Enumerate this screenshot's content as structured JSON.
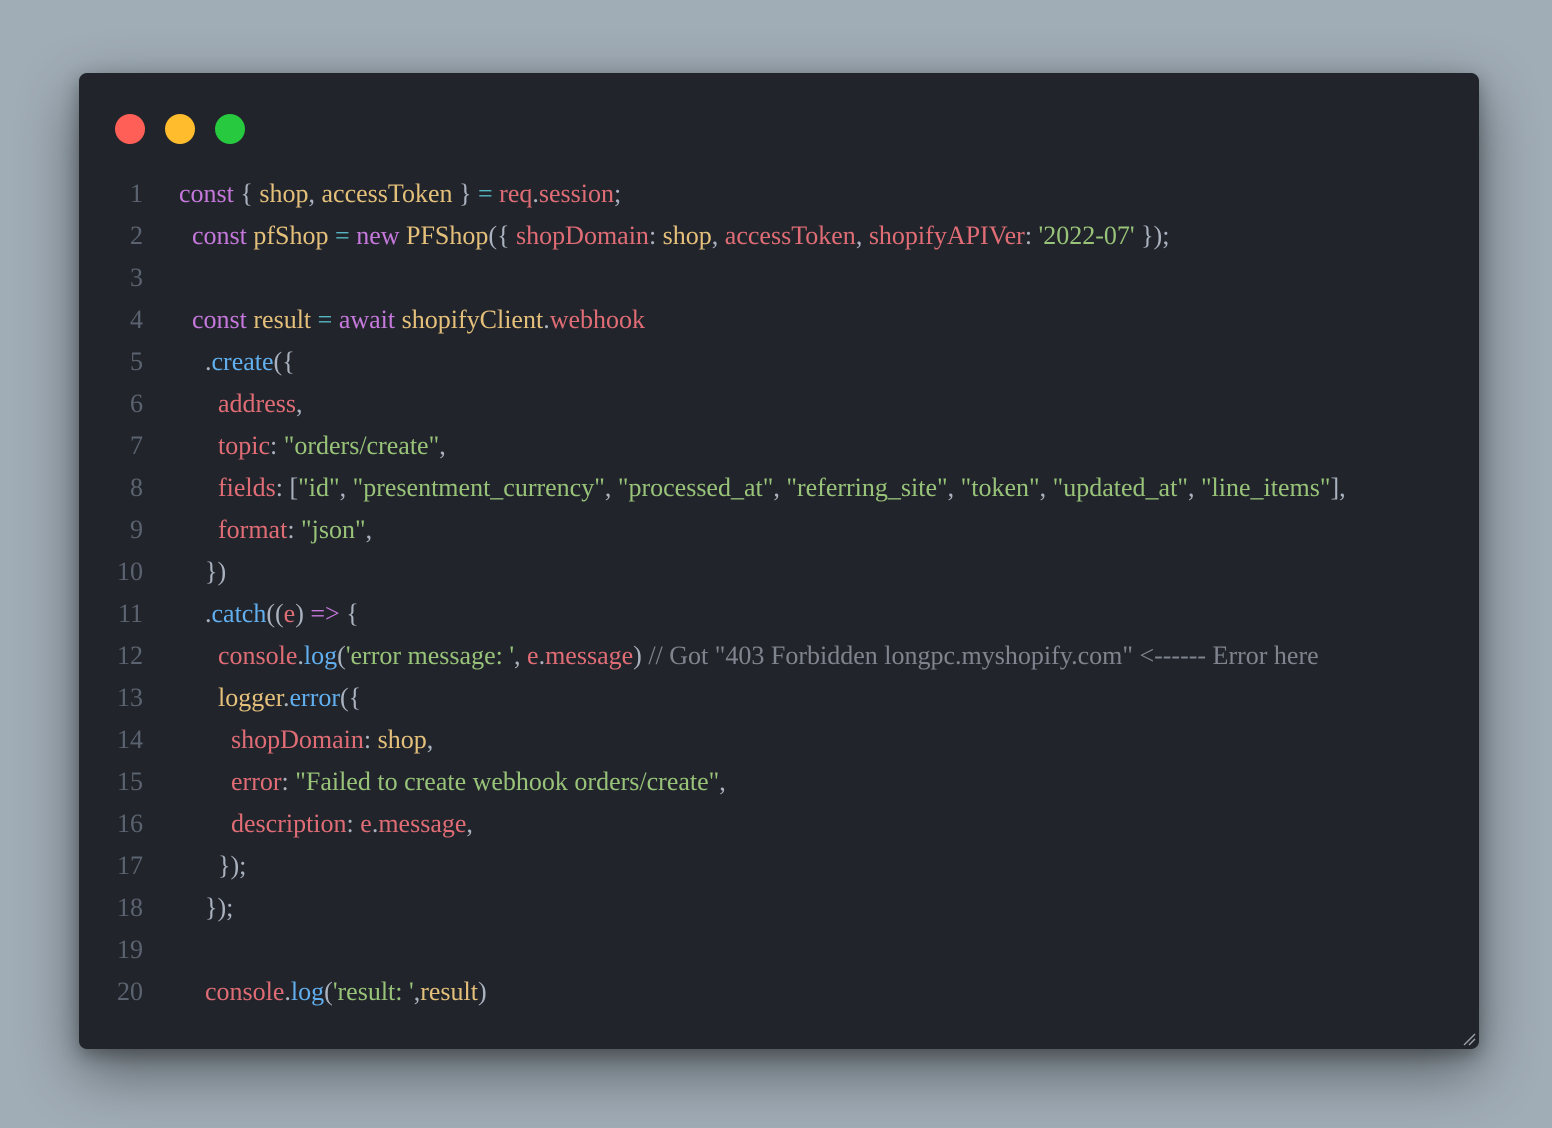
{
  "window": {
    "controls": [
      {
        "name": "close",
        "color": "#ff5f56"
      },
      {
        "name": "minimize",
        "color": "#ffbd2e"
      },
      {
        "name": "maximize",
        "color": "#27c93f"
      }
    ]
  },
  "code": {
    "lines": [
      {
        "n": "1",
        "indent": "",
        "tokens": [
          [
            "const",
            "kw"
          ],
          [
            " { ",
            "pun"
          ],
          [
            "shop",
            "var"
          ],
          [
            ", ",
            "pun"
          ],
          [
            "accessToken",
            "var"
          ],
          [
            " } ",
            "pun"
          ],
          [
            "=",
            "op"
          ],
          [
            " ",
            "pun"
          ],
          [
            "req",
            "prop"
          ],
          [
            ".",
            "pun"
          ],
          [
            "session",
            "prop"
          ],
          [
            ";",
            "pun"
          ]
        ]
      },
      {
        "n": "2",
        "indent": "  ",
        "tokens": [
          [
            "const",
            "kw"
          ],
          [
            " ",
            "pun"
          ],
          [
            "pfShop",
            "var"
          ],
          [
            " ",
            "pun"
          ],
          [
            "=",
            "op"
          ],
          [
            " ",
            "pun"
          ],
          [
            "new",
            "kw"
          ],
          [
            " ",
            "pun"
          ],
          [
            "PFShop",
            "var"
          ],
          [
            "({ ",
            "pun"
          ],
          [
            "shopDomain",
            "prop"
          ],
          [
            ": ",
            "pun"
          ],
          [
            "shop",
            "var"
          ],
          [
            ", ",
            "pun"
          ],
          [
            "accessToken",
            "prop"
          ],
          [
            ", ",
            "pun"
          ],
          [
            "shopifyAPIVer",
            "prop"
          ],
          [
            ": ",
            "pun"
          ],
          [
            "'2022-07'",
            "str"
          ],
          [
            " });",
            "pun"
          ]
        ]
      },
      {
        "n": "3",
        "indent": "",
        "tokens": []
      },
      {
        "n": "4",
        "indent": "  ",
        "tokens": [
          [
            "const",
            "kw"
          ],
          [
            " ",
            "pun"
          ],
          [
            "result",
            "var"
          ],
          [
            " ",
            "pun"
          ],
          [
            "=",
            "op"
          ],
          [
            " ",
            "pun"
          ],
          [
            "await",
            "kw"
          ],
          [
            " ",
            "pun"
          ],
          [
            "shopifyClient",
            "var"
          ],
          [
            ".",
            "pun"
          ],
          [
            "webhook",
            "prop"
          ]
        ]
      },
      {
        "n": "5",
        "indent": "    ",
        "tokens": [
          [
            ".",
            "pun"
          ],
          [
            "create",
            "fn"
          ],
          [
            "({",
            "pun"
          ]
        ]
      },
      {
        "n": "6",
        "indent": "      ",
        "tokens": [
          [
            "address",
            "prop"
          ],
          [
            ",",
            "pun"
          ]
        ]
      },
      {
        "n": "7",
        "indent": "      ",
        "tokens": [
          [
            "topic",
            "prop"
          ],
          [
            ": ",
            "pun"
          ],
          [
            "\"orders/create\"",
            "str"
          ],
          [
            ",",
            "pun"
          ]
        ]
      },
      {
        "n": "8",
        "indent": "      ",
        "tokens": [
          [
            "fields",
            "prop"
          ],
          [
            ": [",
            "pun"
          ],
          [
            "\"id\"",
            "str"
          ],
          [
            ", ",
            "pun"
          ],
          [
            "\"presentment_currency\"",
            "str"
          ],
          [
            ", ",
            "pun"
          ],
          [
            "\"processed_at\"",
            "str"
          ],
          [
            ", ",
            "pun"
          ],
          [
            "\"referring_site\"",
            "str"
          ],
          [
            ", ",
            "pun"
          ],
          [
            "\"token\"",
            "str"
          ],
          [
            ", ",
            "pun"
          ],
          [
            "\"updated_at\"",
            "str"
          ],
          [
            ", ",
            "pun"
          ],
          [
            "\"line_items\"",
            "str"
          ],
          [
            "],",
            "pun"
          ]
        ]
      },
      {
        "n": "9",
        "indent": "      ",
        "tokens": [
          [
            "format",
            "prop"
          ],
          [
            ": ",
            "pun"
          ],
          [
            "\"json\"",
            "str"
          ],
          [
            ",",
            "pun"
          ]
        ]
      },
      {
        "n": "10",
        "indent": "    ",
        "tokens": [
          [
            "})",
            "pun"
          ]
        ]
      },
      {
        "n": "11",
        "indent": "    ",
        "tokens": [
          [
            ".",
            "pun"
          ],
          [
            "catch",
            "fn"
          ],
          [
            "((",
            "pun"
          ],
          [
            "e",
            "prop"
          ],
          [
            ") ",
            "pun"
          ],
          [
            "=>",
            "kw"
          ],
          [
            " {",
            "pun"
          ]
        ]
      },
      {
        "n": "12",
        "indent": "      ",
        "tokens": [
          [
            "console",
            "prop"
          ],
          [
            ".",
            "pun"
          ],
          [
            "log",
            "fn"
          ],
          [
            "(",
            "pun"
          ],
          [
            "'error message: '",
            "str"
          ],
          [
            ", ",
            "pun"
          ],
          [
            "e",
            "prop"
          ],
          [
            ".",
            "pun"
          ],
          [
            "message",
            "prop"
          ],
          [
            ") ",
            "pun"
          ],
          [
            "// Got \"403 Forbidden longpc.myshopify.com\" <------ Error here",
            "cmt"
          ]
        ]
      },
      {
        "n": "13",
        "indent": "      ",
        "tokens": [
          [
            "logger",
            "var"
          ],
          [
            ".",
            "pun"
          ],
          [
            "error",
            "fn"
          ],
          [
            "({",
            "pun"
          ]
        ]
      },
      {
        "n": "14",
        "indent": "        ",
        "tokens": [
          [
            "shopDomain",
            "prop"
          ],
          [
            ": ",
            "pun"
          ],
          [
            "shop",
            "var"
          ],
          [
            ",",
            "pun"
          ]
        ]
      },
      {
        "n": "15",
        "indent": "        ",
        "tokens": [
          [
            "error",
            "prop"
          ],
          [
            ": ",
            "pun"
          ],
          [
            "\"Failed to create webhook orders/create\"",
            "str"
          ],
          [
            ",",
            "pun"
          ]
        ]
      },
      {
        "n": "16",
        "indent": "        ",
        "tokens": [
          [
            "description",
            "prop"
          ],
          [
            ": ",
            "pun"
          ],
          [
            "e",
            "prop"
          ],
          [
            ".",
            "pun"
          ],
          [
            "message",
            "prop"
          ],
          [
            ",",
            "pun"
          ]
        ]
      },
      {
        "n": "17",
        "indent": "      ",
        "tokens": [
          [
            "});",
            "pun"
          ]
        ]
      },
      {
        "n": "18",
        "indent": "    ",
        "tokens": [
          [
            "});",
            "pun"
          ]
        ]
      },
      {
        "n": "19",
        "indent": "",
        "tokens": []
      },
      {
        "n": "20",
        "indent": "    ",
        "tokens": [
          [
            "console",
            "prop"
          ],
          [
            ".",
            "pun"
          ],
          [
            "log",
            "fn"
          ],
          [
            "(",
            "pun"
          ],
          [
            "'result: '",
            "str"
          ],
          [
            ",",
            "pun"
          ],
          [
            "result",
            "var"
          ],
          [
            ")",
            "pun"
          ]
        ]
      }
    ]
  }
}
